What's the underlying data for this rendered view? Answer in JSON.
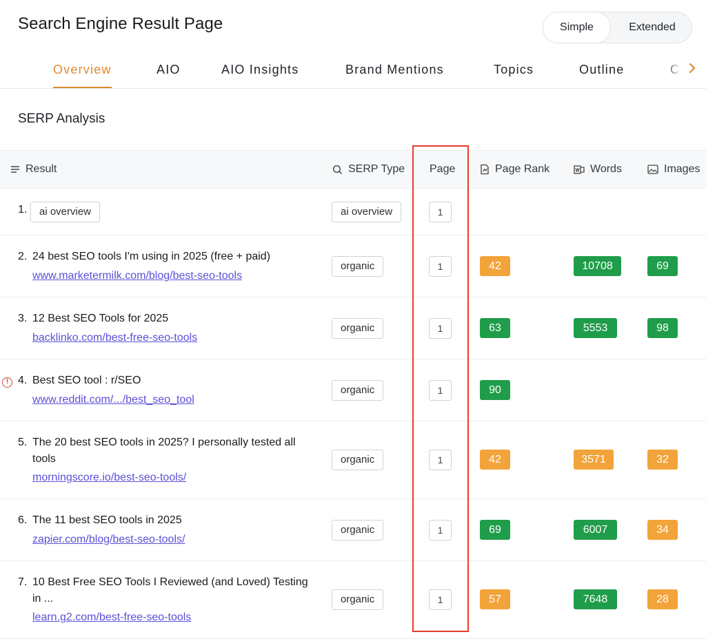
{
  "header": {
    "title": "Search Engine Result Page",
    "toggle": {
      "simple": "Simple",
      "extended": "Extended",
      "selected": "Simple"
    }
  },
  "tabs": [
    {
      "label": "Overview",
      "active": true
    },
    {
      "label": "AIO"
    },
    {
      "label": "AIO Insights"
    },
    {
      "label": "Brand Mentions"
    },
    {
      "label": "Topics"
    },
    {
      "label": "Outline"
    },
    {
      "label": "C"
    }
  ],
  "section": {
    "title": "SERP Analysis"
  },
  "table": {
    "columns": {
      "result": "Result",
      "serp_type": "SERP Type",
      "page": "Page",
      "page_rank": "Page Rank",
      "words": "Words",
      "images": "Images"
    },
    "rows": [
      {
        "num": "1.",
        "title": "",
        "chip": "ai overview",
        "url": "",
        "type": "ai overview",
        "page": "1",
        "page_rank": "",
        "words": "",
        "images": ""
      },
      {
        "num": "2.",
        "title": "24 best SEO tools I'm using in 2025 (free + paid)",
        "url": "www.marketermilk.com/blog/best-seo-tools",
        "type": "organic",
        "page": "1",
        "page_rank": "42",
        "words": "10708",
        "images": "69"
      },
      {
        "num": "3.",
        "title": "12 Best SEO Tools for 2025",
        "url": "backlinko.com/best-free-seo-tools",
        "type": "organic",
        "page": "1",
        "page_rank": "63",
        "words": "5553",
        "images": "98"
      },
      {
        "num": "4.",
        "title": "Best SEO tool : r/SEO",
        "url": "www.reddit.com/.../best_seo_tool",
        "type": "organic",
        "page": "1",
        "page_rank": "90",
        "words": "",
        "images": "",
        "alert": "!"
      },
      {
        "num": "5.",
        "title": "The 20 best SEO tools in 2025? I personally tested all tools",
        "url": "morningscore.io/best-seo-tools/",
        "type": "organic",
        "page": "1",
        "page_rank": "42",
        "words": "3571",
        "images": "32"
      },
      {
        "num": "6.",
        "title": "The 11 best SEO tools in 2025",
        "url": "zapier.com/blog/best-seo-tools/",
        "type": "organic",
        "page": "1",
        "page_rank": "69",
        "words": "6007",
        "images": "34"
      },
      {
        "num": "7.",
        "title": "10 Best Free SEO Tools I Reviewed (and Loved) Testing in ...",
        "url": "learn.g2.com/best-free-seo-tools",
        "type": "organic",
        "page": "1",
        "page_rank": "57",
        "words": "7648",
        "images": "28"
      }
    ]
  },
  "colors": {
    "accent": "#e08a2c",
    "green": "#1f9d4a",
    "orange": "#f2a33a",
    "link": "#5b4fd6",
    "highlight": "#e83a28"
  }
}
